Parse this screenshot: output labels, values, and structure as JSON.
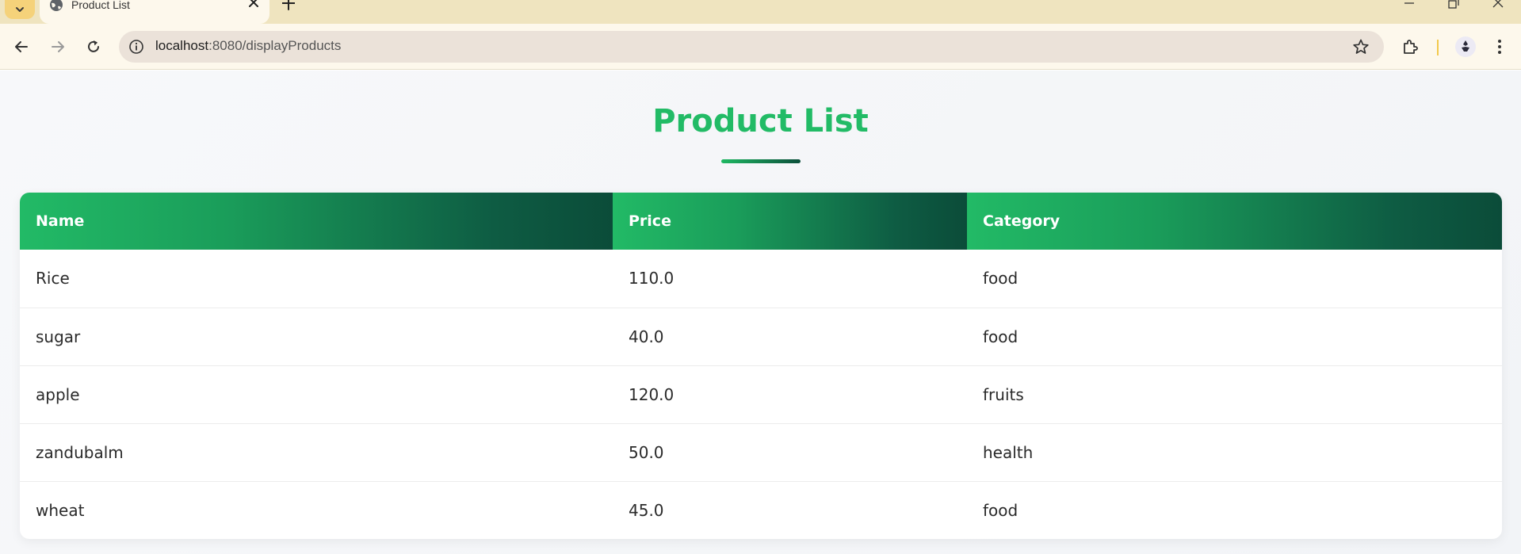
{
  "browser": {
    "tab_title": "Product List",
    "url_host": "localhost",
    "url_path": ":8080/displayProducts"
  },
  "page": {
    "title": "Product List",
    "accent_color": "#22bb66",
    "header_gradient": [
      "#22ba66",
      "#0b4c39"
    ]
  },
  "table": {
    "headers": [
      "Name",
      "Price",
      "Category"
    ],
    "rows": [
      {
        "name": "Rice",
        "price": "110.0",
        "category": "food"
      },
      {
        "name": "sugar",
        "price": "40.0",
        "category": "food"
      },
      {
        "name": "apple",
        "price": "120.0",
        "category": "fruits"
      },
      {
        "name": "zandubalm",
        "price": "50.0",
        "category": "health"
      },
      {
        "name": "wheat",
        "price": "45.0",
        "category": "food"
      }
    ]
  }
}
